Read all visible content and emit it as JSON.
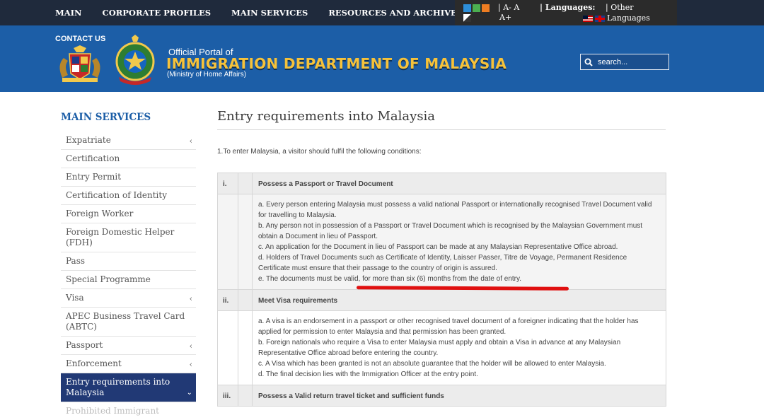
{
  "topnav": {
    "items": [
      "MAIN",
      "CORPORATE PROFILES",
      "MAIN SERVICES",
      "RESOURCES AND ARCHIVES"
    ]
  },
  "toolbox": {
    "fontsize_row1": "| A-  A",
    "fontsize_row2": "A+",
    "languages_label": "| Languages:",
    "other_label": "| Other",
    "languages_text": "Languages"
  },
  "banner": {
    "contact": "CONTACT US",
    "portal_line": "Official Portal of",
    "portal_title": "IMMIGRATION DEPARTMENT OF MALAYSIA",
    "portal_sub": "(Ministry of Home Affairs)",
    "search_placeholder": "search..."
  },
  "sidebar": {
    "title": "MAIN SERVICES",
    "items": [
      {
        "label": "Expatriate",
        "chevron": "‹"
      },
      {
        "label": "Certification",
        "chevron": ""
      },
      {
        "label": "Entry Permit",
        "chevron": ""
      },
      {
        "label": "Certification of Identity",
        "chevron": ""
      },
      {
        "label": "Foreign Worker",
        "chevron": ""
      },
      {
        "label": "Foreign Domestic Helper (FDH)",
        "chevron": ""
      },
      {
        "label": "Pass",
        "chevron": ""
      },
      {
        "label": "Special Programme",
        "chevron": ""
      },
      {
        "label": "Visa",
        "chevron": "‹"
      },
      {
        "label": "APEC Business Travel Card (ABTC)",
        "chevron": ""
      },
      {
        "label": "Passport",
        "chevron": "‹"
      },
      {
        "label": "Enforcement",
        "chevron": "‹"
      },
      {
        "label": "Entry requirements into Malaysia",
        "chevron": "⌄"
      },
      {
        "label": "Prohibited Immigrant",
        "chevron": ""
      }
    ]
  },
  "main": {
    "title": "Entry requirements into Malaysia",
    "intro": "1.To enter Malaysia, a visitor should fulfil the following conditions:",
    "rows": [
      {
        "num": "i.",
        "heading": "Possess a Passport or Travel Document",
        "lines": [
          "a. Every person entering Malaysia must possess a valid national Passport or internationally recognised Travel Document valid for travelling to Malaysia.",
          "b. Any person not in possession of a Passport or Travel Document which is recognised by the Malaysian Government must obtain a Document in lieu of Passport.",
          "c. An application for the Document in lieu of Passport can be made at any Malaysian Representative Office abroad.",
          "d. Holders of Travel Documents such as Certificate of Identity, Laisser Passer, Titre de Voyage, Permanent Residence Certificate must ensure that their passage to the country of origin is assured.",
          "e. The documents must be valid, for more than six (6) months from the date of entry."
        ]
      },
      {
        "num": "ii.",
        "heading": "Meet Visa requirements",
        "lines": [
          "a. A visa is an endorsement in a passport or other recognised travel document of a foreigner indicating that the holder has applied for permission to enter Malaysia and that permission has been granted.",
          "b. Foreign nationals who require a Visa to enter Malaysia must apply and obtain a Visa in advance at any Malaysian Representative Office abroad before entering the country.",
          "c. A Visa which has been granted is not an absolute guarantee that the holder will be allowed to enter Malaysia.",
          "d. The final decision lies with the Immigration Officer at the entry point."
        ]
      },
      {
        "num": "iii.",
        "heading": "Possess a Valid return travel ticket and sufficient funds",
        "lines": []
      }
    ]
  }
}
